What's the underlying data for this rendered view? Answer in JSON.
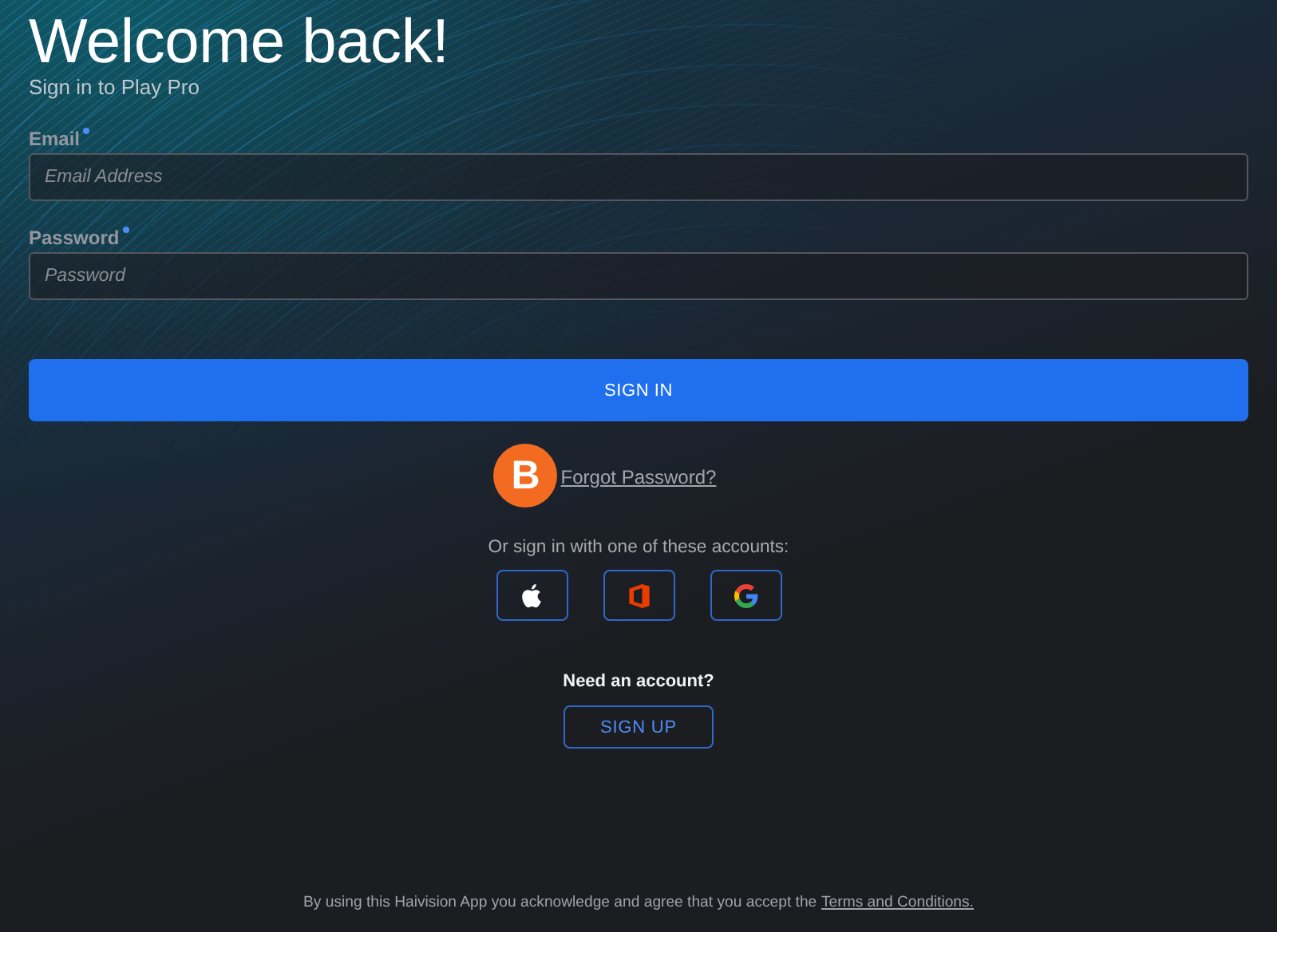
{
  "header": {
    "title": "Welcome back!",
    "subtitle": "Sign in to Play Pro"
  },
  "fields": [
    {
      "label": "Email",
      "required": true,
      "placeholder": "Email Address"
    },
    {
      "label": "Password",
      "required": true,
      "placeholder": "Password"
    }
  ],
  "sign_in_button": "SIGN IN",
  "overlay_badge": {
    "letter": "B"
  },
  "forgot_link": "Forgot Password?",
  "social": {
    "prompt": "Or sign in with one of these accounts:",
    "providers": [
      {
        "kind": "apple"
      },
      {
        "kind": "office"
      },
      {
        "kind": "google"
      }
    ]
  },
  "signup": {
    "prompt": "Need an account?",
    "button": "SIGN UP"
  },
  "footer": {
    "text": "By using this Haivision App you acknowledge and agree that you accept the",
    "link": "Terms and Conditions."
  }
}
